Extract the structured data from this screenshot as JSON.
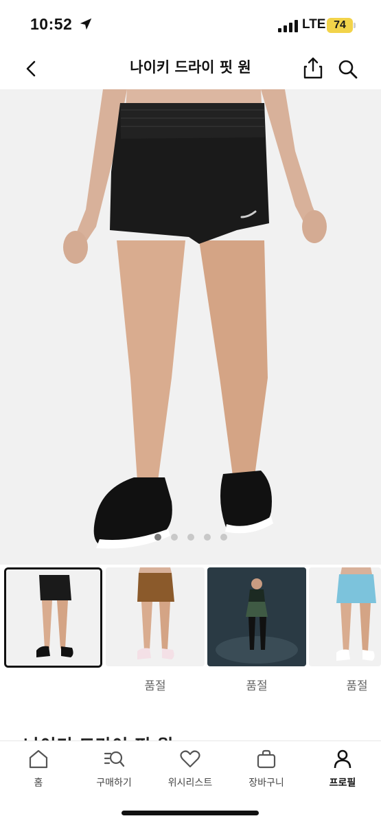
{
  "status_bar": {
    "time": "10:52",
    "network": "LTE",
    "battery": "74"
  },
  "nav": {
    "title": "나이키 드라이 핏 원"
  },
  "carousel": {
    "pages": 5,
    "active_index": 0
  },
  "thumbnails": [
    {
      "status": ""
    },
    {
      "status": "품절"
    },
    {
      "status": "품절"
    },
    {
      "status": "품절"
    }
  ],
  "product": {
    "title": "나이키 드라이 핏 원"
  },
  "tabbar": {
    "items": [
      {
        "label": "홈",
        "icon": "home-icon"
      },
      {
        "label": "구매하기",
        "icon": "search-list-icon"
      },
      {
        "label": "위시리스트",
        "icon": "heart-icon"
      },
      {
        "label": "장바구니",
        "icon": "bag-icon"
      },
      {
        "label": "프로필",
        "icon": "person-icon"
      }
    ],
    "active_index": 4
  },
  "colors": {
    "battery": "#f2d34a",
    "hero_bg": "#f1f1f1",
    "shorts_black": "#1a1a1a",
    "shorts_brown": "#8b5a2b",
    "shorts_green": "#3f5a44",
    "shorts_blue": "#7cc3dc"
  }
}
